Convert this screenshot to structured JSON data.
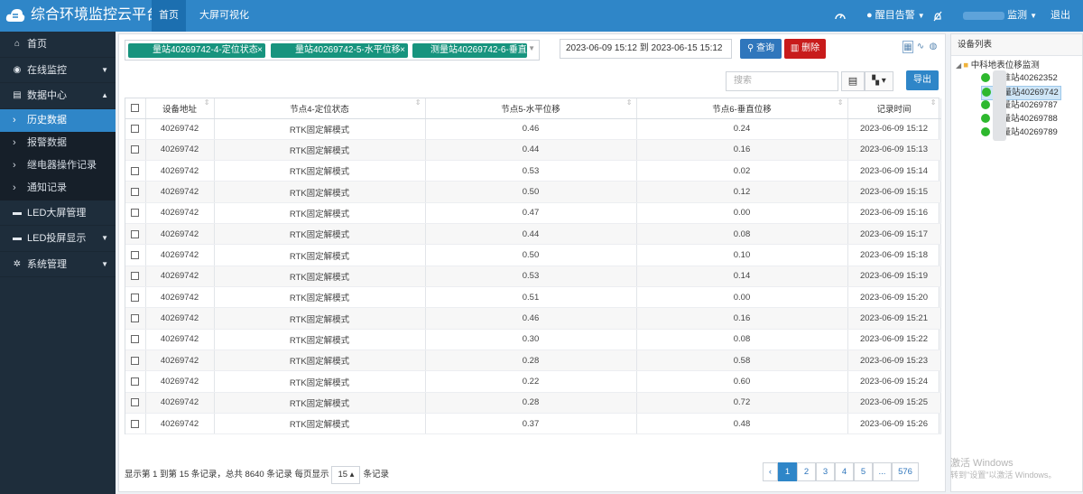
{
  "header": {
    "app_title": "综合环境监控云平台",
    "nav": [
      "首页",
      "大屏可视化"
    ],
    "alarm_label": "醒目告警",
    "user_label": "监测",
    "logout": "退出"
  },
  "sidebar": {
    "items": [
      {
        "label": "首页",
        "icon": "home-icon"
      },
      {
        "label": "在线监控",
        "icon": "globe-icon",
        "arrow": "▼"
      },
      {
        "label": "数据中心",
        "icon": "data-icon",
        "arrow": "▲"
      },
      {
        "label": "LED大屏管理",
        "icon": "led-icon"
      },
      {
        "label": "LED投屏显示",
        "icon": "cast-icon",
        "arrow": "▼"
      },
      {
        "label": "系统管理",
        "icon": "gear-icon",
        "arrow": "▼"
      }
    ],
    "subitems": [
      "历史数据",
      "报警数据",
      "继电器操作记录",
      "通知记录"
    ]
  },
  "filter": {
    "tags": [
      "量站40269742-4-定位状态",
      "量站40269742-5-水平位移",
      "测量站40269742-6-垂直位"
    ],
    "daterange": "2023-06-09 15:12 到 2023-06-15 15:12",
    "query": "查询",
    "delete": "删除"
  },
  "toolbar": {
    "search_placeholder": "搜索",
    "export": "导出"
  },
  "table": {
    "headers": [
      "设备地址",
      "节点4-定位状态",
      "节点5-水平位移",
      "节点6-垂直位移",
      "记录时间"
    ],
    "rows": [
      [
        "40269742",
        "RTK固定解模式",
        "0.46",
        "0.24",
        "2023-06-09 15:12"
      ],
      [
        "40269742",
        "RTK固定解模式",
        "0.44",
        "0.16",
        "2023-06-09 15:13"
      ],
      [
        "40269742",
        "RTK固定解模式",
        "0.53",
        "0.02",
        "2023-06-09 15:14"
      ],
      [
        "40269742",
        "RTK固定解模式",
        "0.50",
        "0.12",
        "2023-06-09 15:15"
      ],
      [
        "40269742",
        "RTK固定解模式",
        "0.47",
        "0.00",
        "2023-06-09 15:16"
      ],
      [
        "40269742",
        "RTK固定解模式",
        "0.44",
        "0.08",
        "2023-06-09 15:17"
      ],
      [
        "40269742",
        "RTK固定解模式",
        "0.50",
        "0.10",
        "2023-06-09 15:18"
      ],
      [
        "40269742",
        "RTK固定解模式",
        "0.53",
        "0.14",
        "2023-06-09 15:19"
      ],
      [
        "40269742",
        "RTK固定解模式",
        "0.51",
        "0.00",
        "2023-06-09 15:20"
      ],
      [
        "40269742",
        "RTK固定解模式",
        "0.46",
        "0.16",
        "2023-06-09 15:21"
      ],
      [
        "40269742",
        "RTK固定解模式",
        "0.30",
        "0.08",
        "2023-06-09 15:22"
      ],
      [
        "40269742",
        "RTK固定解模式",
        "0.28",
        "0.58",
        "2023-06-09 15:23"
      ],
      [
        "40269742",
        "RTK固定解模式",
        "0.22",
        "0.60",
        "2023-06-09 15:24"
      ],
      [
        "40269742",
        "RTK固定解模式",
        "0.28",
        "0.72",
        "2023-06-09 15:25"
      ],
      [
        "40269742",
        "RTK固定解模式",
        "0.37",
        "0.48",
        "2023-06-09 15:26"
      ]
    ]
  },
  "footer": {
    "info_prefix": "显示第 1 到第 15 条记录，总共 8640 条记录 每页显示",
    "page_size": "15 ▴",
    "info_suffix": "条记录"
  },
  "pagination": [
    "‹",
    "1",
    "2",
    "3",
    "4",
    "5",
    "...",
    "576"
  ],
  "device_tree": {
    "title": "设备列表",
    "root": "中科地表位移监测",
    "children": [
      "基准站40262352",
      "测量站40269742",
      "测量站40269787",
      "测量站40269788",
      "测量站40269789"
    ]
  },
  "watermark": {
    "line1": "激活 Windows",
    "line2": "转到\"设置\"以激活 Windows。"
  }
}
